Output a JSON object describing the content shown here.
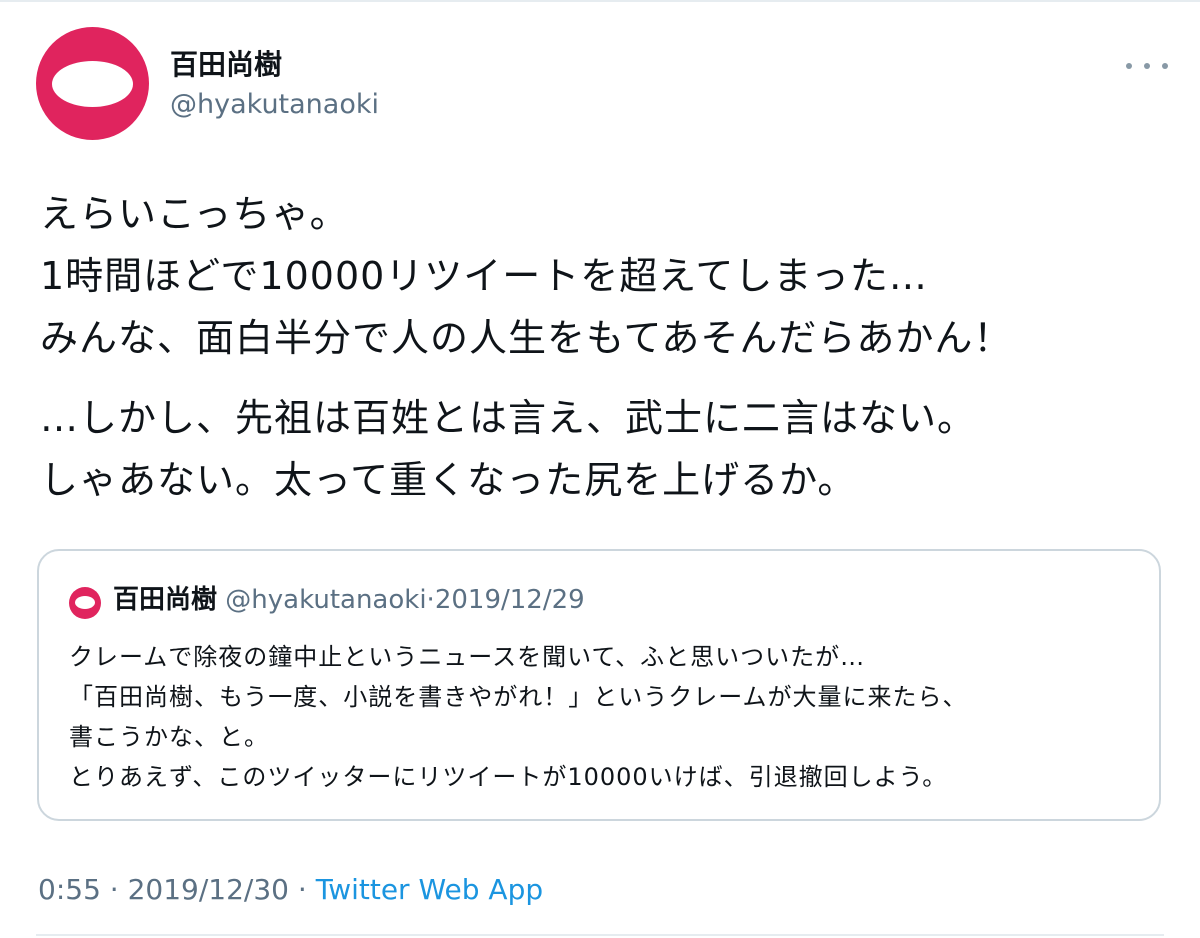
{
  "tweet": {
    "author": {
      "display_name": "百田尚樹",
      "handle": "@hyakutanaoki"
    },
    "text_lines": [
      "えらいこっちゃ。",
      "1時間ほどで10000リツイートを超えてしまった…",
      "みんな、面白半分で人の人生をもてあそんだらあかん！",
      "…しかし、先祖は百姓とは言え、武士に二言はない。",
      "しゃあない。太って重くなった尻を上げるか。"
    ],
    "quoted": {
      "display_name": "百田尚樹",
      "handle": "@hyakutanaoki",
      "separator": "·",
      "date": "2019/12/29",
      "text_lines": [
        "クレームで除夜の鐘中止というニュースを聞いて、ふと思いついたが…",
        "「百田尚樹、もう一度、小説を書きやがれ！」というクレームが大量に来たら、",
        "書こうかな、と。",
        "とりあえず、このツイッターにリツイートが10000いけば、引退撤回しよう。"
      ]
    },
    "footer": {
      "time": "0:55",
      "separator": "·",
      "date": "2019/12/30",
      "source": "Twitter Web App"
    }
  },
  "icons": {
    "avatar": "avatar-icon",
    "more": "more-icon"
  },
  "colors": {
    "avatar_bg": "#e0245e",
    "secondary_text": "#5b7083",
    "link": "#1b95e0",
    "border": "#ccd6dd"
  }
}
